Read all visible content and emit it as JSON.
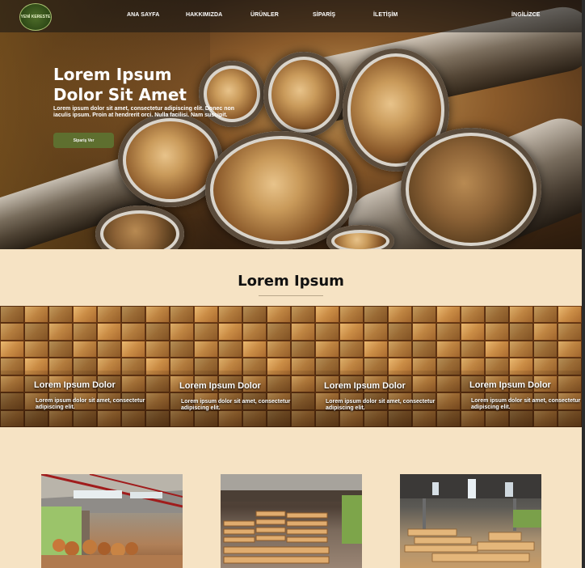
{
  "nav": {
    "logo_text": "YENİ KERESTE",
    "items": [
      "ANA SAYFA",
      "HAKKIMIZDA",
      "ÜRÜNLER",
      "SİPARİŞ",
      "İLETİŞİM",
      "İNGİLİZCE"
    ]
  },
  "hero": {
    "title_line1": "Lorem Ipsum",
    "title_line2": "Dolor Sit Amet",
    "text": "Lorem ipsum dolor sit amet, consectetur adipiscing elit. Donec non iaculis ipsum. Proin at hendrerit orci. Nulla facilisi. Nam suscipit.",
    "button": "Sipariş Ver"
  },
  "section": {
    "title": "Lorem Ipsum",
    "features": [
      {
        "title": "Lorem Ipsum Dolor",
        "text": "Lorem ipsum dolor sit amet, consectetur adipiscing elit."
      },
      {
        "title": "Lorem Ipsum Dolor",
        "text": "Lorem ipsum dolor sit amet, consectetur adipiscing elit."
      },
      {
        "title": "Lorem Ipsum Dolor",
        "text": "Lorem ipsum dolor sit amet, consectetur adipiscing elit."
      },
      {
        "title": "Lorem Ipsum Dolor",
        "text": "Lorem ipsum dolor sit amet, consectetur adipiscing elit."
      }
    ]
  },
  "colors": {
    "page_bg": "#f6e3c4",
    "button": "#5e6f2f",
    "nav_bg": "#141414"
  },
  "gallery": [
    "warehouse-logs-photo",
    "pallet-stack-photo",
    "lumber-yard-photo"
  ]
}
